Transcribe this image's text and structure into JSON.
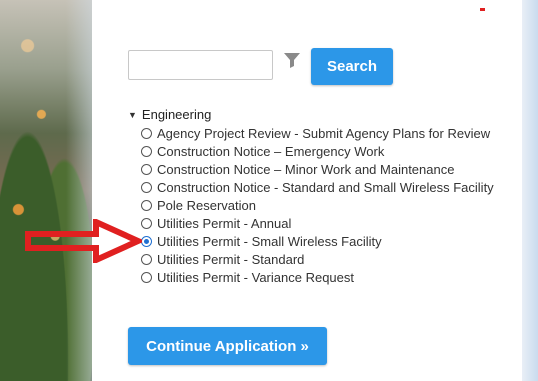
{
  "search": {
    "value": "",
    "placeholder": "",
    "button_label": "Search"
  },
  "group": {
    "label": "Engineering",
    "options": [
      {
        "label": "Agency Project Review - Submit Agency Plans for Review",
        "checked": false
      },
      {
        "label": "Construction Notice – Emergency Work",
        "checked": false
      },
      {
        "label": "Construction Notice – Minor Work and Maintenance",
        "checked": false
      },
      {
        "label": "Construction Notice - Standard and Small Wireless Facility",
        "checked": false
      },
      {
        "label": "Pole Reservation",
        "checked": false
      },
      {
        "label": "Utilities Permit - Annual",
        "checked": false
      },
      {
        "label": "Utilities Permit - Small Wireless Facility",
        "checked": true
      },
      {
        "label": "Utilities Permit - Standard",
        "checked": false
      },
      {
        "label": "Utilities Permit - Variance Request",
        "checked": false
      }
    ]
  },
  "continue_button_label": "Continue Application »",
  "icons": {
    "filter": "filter-icon",
    "caret": "caret-down-icon",
    "annotation": "red-arrow"
  },
  "colors": {
    "accent": "#2c97e8",
    "annotation": "#e02020",
    "background": "#c9dbee"
  }
}
